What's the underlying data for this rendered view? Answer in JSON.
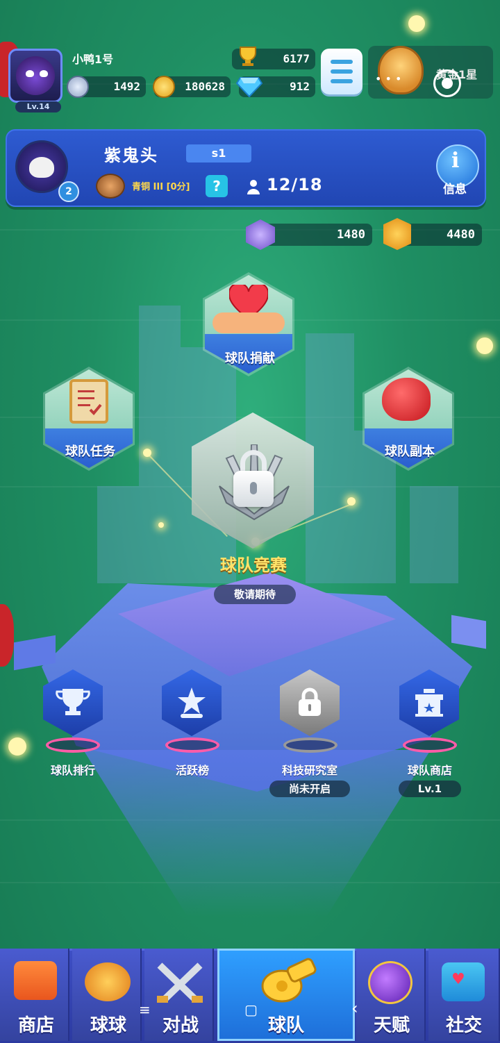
{
  "player": {
    "name": "小鸭1号",
    "level": "Lv.14",
    "trophies": "6177",
    "silver": "1492",
    "gold": "180628",
    "diamonds": "912",
    "rank_text": "黄金1星"
  },
  "team": {
    "name": "紫鬼头",
    "season": "s1",
    "level_badge": "2",
    "rank": "青铜 III [0分]",
    "help": "?",
    "members": "12/18",
    "info_label": "信息",
    "stat_purple": "1480",
    "stat_gold": "4480"
  },
  "nodes": {
    "donate": "球队捐献",
    "tasks": "球队任务",
    "dungeon": "球队副本",
    "competition": "球队竞赛",
    "competition_status": "敬请期待"
  },
  "features": [
    {
      "label": "球队排行",
      "sub": ""
    },
    {
      "label": "活跃榜",
      "sub": ""
    },
    {
      "label": "科技研究室",
      "sub": "尚未开启"
    },
    {
      "label": "球队商店",
      "sub": "Lv.1"
    }
  ],
  "nav": [
    {
      "label": "商店"
    },
    {
      "label": "球球"
    },
    {
      "label": "对战"
    },
    {
      "label": "球队"
    },
    {
      "label": "天赋"
    },
    {
      "label": "社交"
    }
  ],
  "system_overlay": {
    "menu_glyph": "≡",
    "home_glyph": "▢",
    "back_glyph": "‹",
    "dots": "• • •"
  },
  "colors": {
    "background": "#1f8f63",
    "panel": "#2146b3",
    "accent_gold": "#ffe36a",
    "active_tab": "#1e6fd9"
  }
}
